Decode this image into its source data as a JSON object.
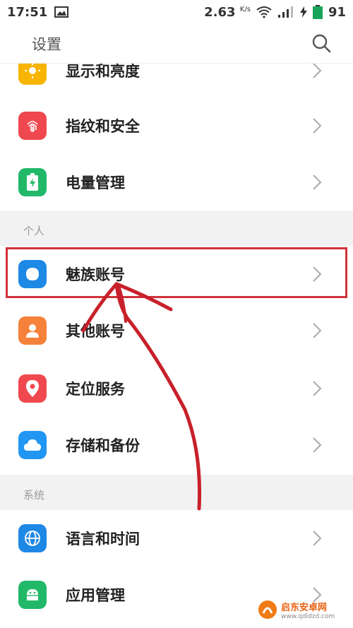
{
  "status_bar": {
    "time": "17:51",
    "speed": "2.63",
    "speed_unit": "K/s",
    "battery": "91"
  },
  "header": {
    "title": "设置"
  },
  "rows_top": [
    {
      "label": "显示和亮度",
      "icon": "sun-icon",
      "color": "#f7b500"
    },
    {
      "label": "指纹和安全",
      "icon": "fingerprint-icon",
      "color": "#f0484f"
    },
    {
      "label": "电量管理",
      "icon": "battery-icon",
      "color": "#21b969"
    }
  ],
  "sections": [
    {
      "label": "个人"
    },
    {
      "label": "系统"
    }
  ],
  "rows_personal": [
    {
      "label": "魅族账号",
      "icon": "meizu-account-icon",
      "color": "#1e88e5"
    },
    {
      "label": "其他账号",
      "icon": "person-icon",
      "color": "#f5813a"
    },
    {
      "label": "定位服务",
      "icon": "location-pin-icon",
      "color": "#f0484f"
    },
    {
      "label": "存储和备份",
      "icon": "cloud-icon",
      "color": "#2196f3"
    }
  ],
  "rows_system": [
    {
      "label": "语言和时间",
      "icon": "globe-icon",
      "color": "#1e88e5"
    },
    {
      "label": "应用管理",
      "icon": "android-icon",
      "color": "#21b969"
    }
  ],
  "watermark": {
    "text": "启东安卓网",
    "url": "www.qdldzd.com"
  },
  "annotation_color": "#d0323a"
}
